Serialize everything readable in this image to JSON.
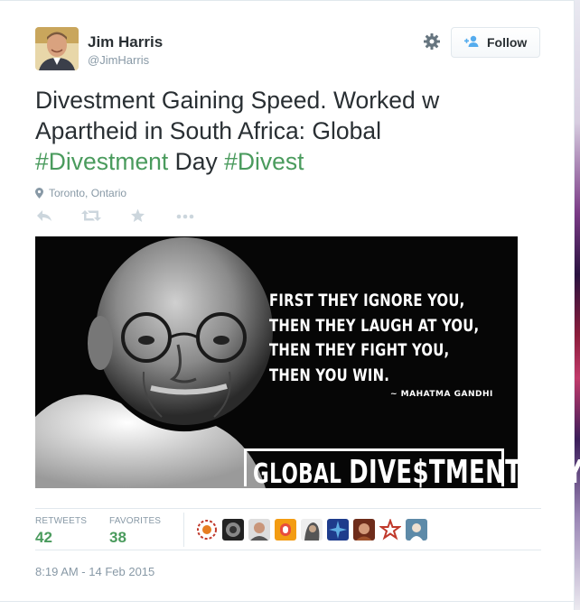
{
  "user": {
    "name": "Jim Harris",
    "handle": "@JimHarris"
  },
  "header": {
    "follow_label": "Follow"
  },
  "tweet": {
    "line1": "Divestment Gaining Speed. Worked w",
    "line2": "Apartheid in South Africa: Global",
    "hashtag1": "#Divestment",
    "word_day": " Day ",
    "hashtag2": "#Divest",
    "location": "Toronto, Ontario"
  },
  "media": {
    "quote_lines": [
      "FIRST THEY IGNORE YOU,",
      "THEN THEY LAUGH AT YOU,",
      "THEN THEY FIGHT YOU,",
      "THEN YOU WIN."
    ],
    "attribution": "~ MAHATMA GANDHI",
    "banner_prefix": "GLOBAL ",
    "banner_word": "DIVE$TMENT DAY"
  },
  "stats": {
    "retweets_label": "RETWEETS",
    "retweets_value": "42",
    "favorites_label": "FAVORITES",
    "favorites_value": "38"
  },
  "timestamp": "8:19 AM - 14 Feb 2015",
  "colors": {
    "hashtag": "#4a9b5d",
    "meta_text": "#8899a6",
    "follow_icon": "#55acee"
  },
  "icons": {
    "settings": "gear-icon",
    "follow": "add-user-icon",
    "location": "map-pin-icon",
    "reply": "reply-icon",
    "retweet": "retweet-icon",
    "favorite": "star-icon",
    "more": "more-icon"
  }
}
